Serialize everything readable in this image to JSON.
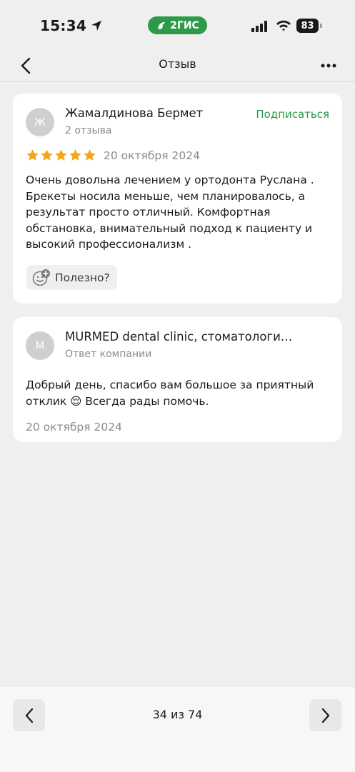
{
  "status_bar": {
    "time": "15:34",
    "app_badge": "2ГИС",
    "battery": "83"
  },
  "nav": {
    "title": "Отзыв"
  },
  "review": {
    "avatar_letter": "Ж",
    "author": "Жамалдинова Бермет",
    "reviews_count": "2 отзыва",
    "subscribe_label": "Подписаться",
    "rating": 5,
    "date": "20 октября 2024",
    "text": "Очень довольна лечением у ортодонта Руслана . Брекеты носила меньше, чем планировалось, а результат просто отличный. Комфортная обстановка, внимательный подход к пациенту и высокий профессионализм .",
    "useful_label": "Полезно?"
  },
  "reply": {
    "avatar_letter": "M",
    "author": "MURMED dental clinic, стоматологи…",
    "role": "Ответ компании",
    "text": "Добрый день, спасибо вам большое за приятный отклик 😌 Всегда рады помочь.",
    "date": "20 октября 2024"
  },
  "pager": {
    "label": "34 из 74"
  },
  "colors": {
    "accent": "#2b9b47",
    "star": "#f2a618",
    "muted": "#8a8a8a"
  },
  "icons": [
    "location-arrow-icon",
    "signal-icon",
    "wifi-icon",
    "battery-icon",
    "back-chevron-icon",
    "more-dots-icon",
    "star-icon",
    "smile-plus-icon",
    "chevron-left-icon",
    "chevron-right-icon"
  ]
}
